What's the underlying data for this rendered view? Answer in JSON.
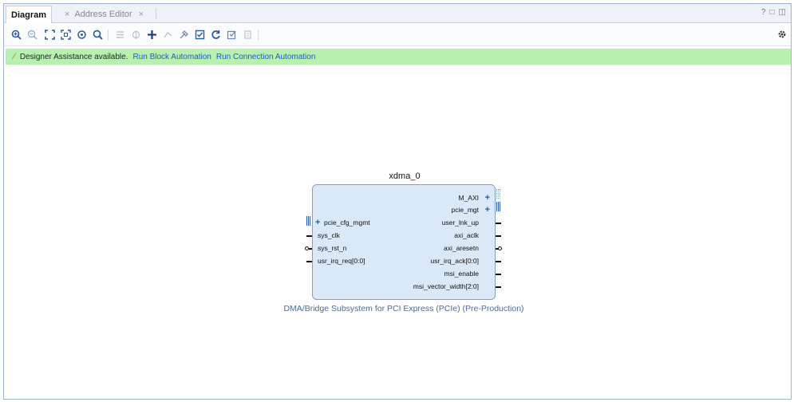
{
  "tabs": [
    {
      "label": "Diagram",
      "active": true
    },
    {
      "label": "Address Editor",
      "active": false
    }
  ],
  "window_controls": [
    "?",
    "□",
    "◫"
  ],
  "toolbar": {
    "icons": [
      "zoom-in-icon",
      "zoom-out-icon",
      "zoom-fit-icon",
      "fit-selection-icon",
      "auto-fit-icon",
      "search-icon",
      "align-icon",
      "center-icon",
      "add-ip-icon",
      "route-icon",
      "properties-icon",
      "validate-icon",
      "regenerate-icon",
      "optimize-icon",
      "pinning-icon"
    ],
    "settings_icon": "gear-icon"
  },
  "assist": {
    "text": "Designer Assistance available.",
    "link_block": "Run Block Automation",
    "link_connection": "Run Connection Automation"
  },
  "block": {
    "name": "xdma_0",
    "subtitle": "DMA/Bridge Subsystem for PCI Express (PCIe) (Pre-Production)",
    "left_ports": [
      "pcie_cfg_mgmt",
      "sys_clk",
      "sys_rst_n",
      "usr_irq_req[0:0]"
    ],
    "right_ports": [
      "M_AXI",
      "pcie_mgt",
      "user_lnk_up",
      "axi_aclk",
      "axi_aresetn",
      "usr_irq_ack[0:0]",
      "msi_enable",
      "msi_vector_width[2:0]"
    ]
  },
  "colors": {
    "assist_bg": "#b8f0b0",
    "block_fill": "#dbe8f8",
    "block_border": "#7fa1c9",
    "link": "#1a5bc8"
  }
}
